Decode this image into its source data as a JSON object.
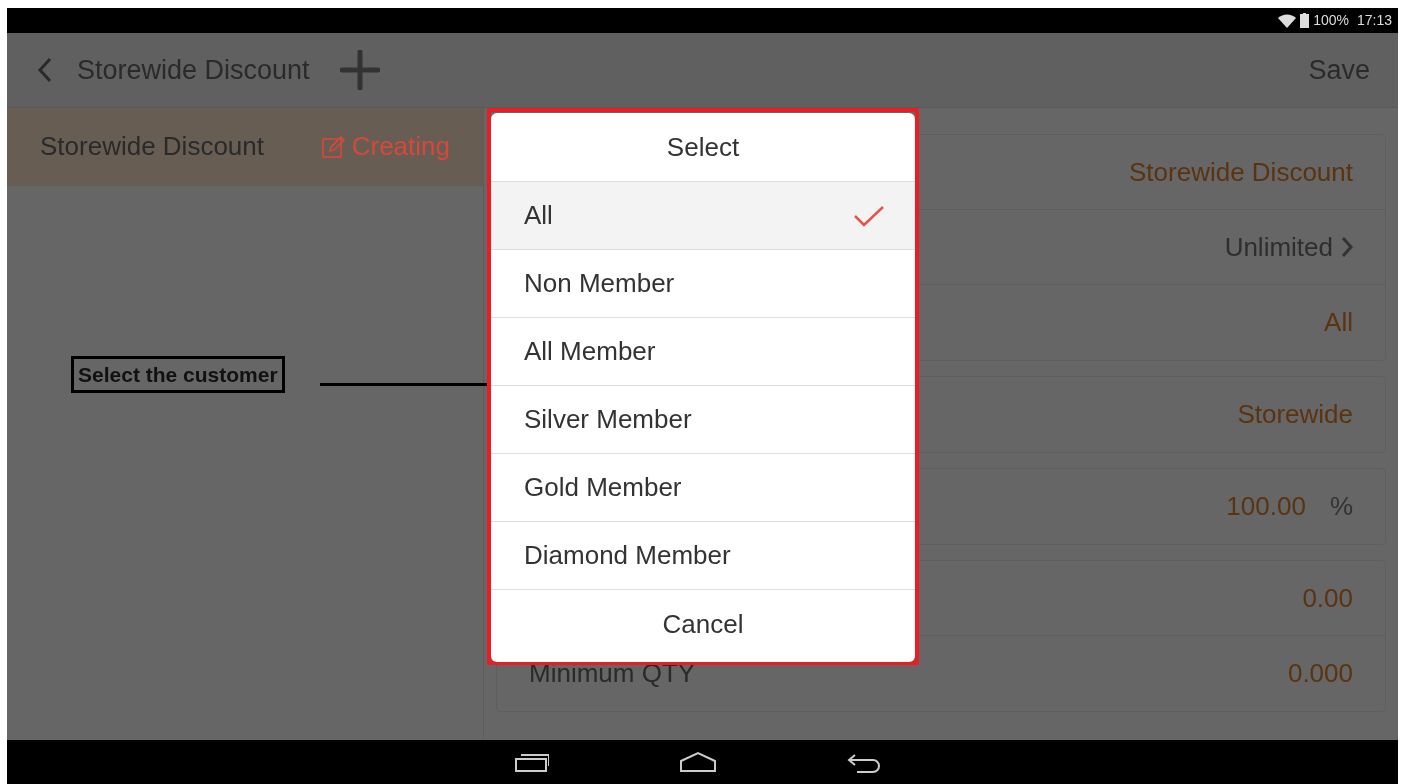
{
  "status_bar": {
    "battery": "100%",
    "time": "17:13"
  },
  "app_bar": {
    "title": "Storewide Discount",
    "action": "Save"
  },
  "list": [
    {
      "name": "Storewide Discount",
      "status": "Creating",
      "selected": true
    }
  ],
  "form_groups": [
    {
      "rows": [
        {
          "kind": "text",
          "value": "Storewide Discount"
        },
        {
          "kind": "link",
          "value": "Unlimited"
        },
        {
          "kind": "text",
          "value": "All"
        }
      ]
    },
    {
      "rows": [
        {
          "kind": "text",
          "value": "Storewide"
        }
      ]
    },
    {
      "rows": [
        {
          "kind": "text",
          "value": "100.00",
          "unit": "%"
        }
      ]
    },
    {
      "rows": [
        {
          "kind": "text",
          "value": "0.00"
        },
        {
          "kind": "text",
          "label": "Minimum QTY",
          "value": "0.000"
        }
      ]
    }
  ],
  "dialog": {
    "title": "Select",
    "options": [
      {
        "label": "All",
        "selected": true
      },
      {
        "label": "Non Member",
        "selected": false
      },
      {
        "label": "All Member",
        "selected": false
      },
      {
        "label": "Silver Member",
        "selected": false
      },
      {
        "label": "Gold Member",
        "selected": false
      },
      {
        "label": "Diamond Member",
        "selected": false
      }
    ],
    "cancel": "Cancel"
  },
  "annotation": {
    "text": "Select the customer"
  }
}
